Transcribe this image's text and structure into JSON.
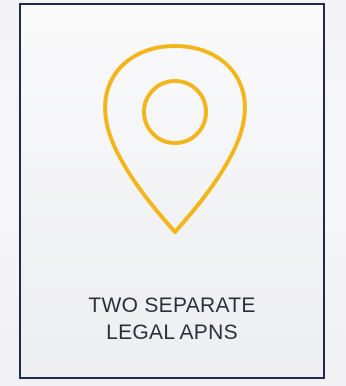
{
  "card": {
    "line1": "TWO SEPARATE",
    "line2": "LEGAL APNS",
    "icon": "map-pin-icon",
    "accent_color": "#f2b51b",
    "border_color": "#1f2a4d"
  }
}
